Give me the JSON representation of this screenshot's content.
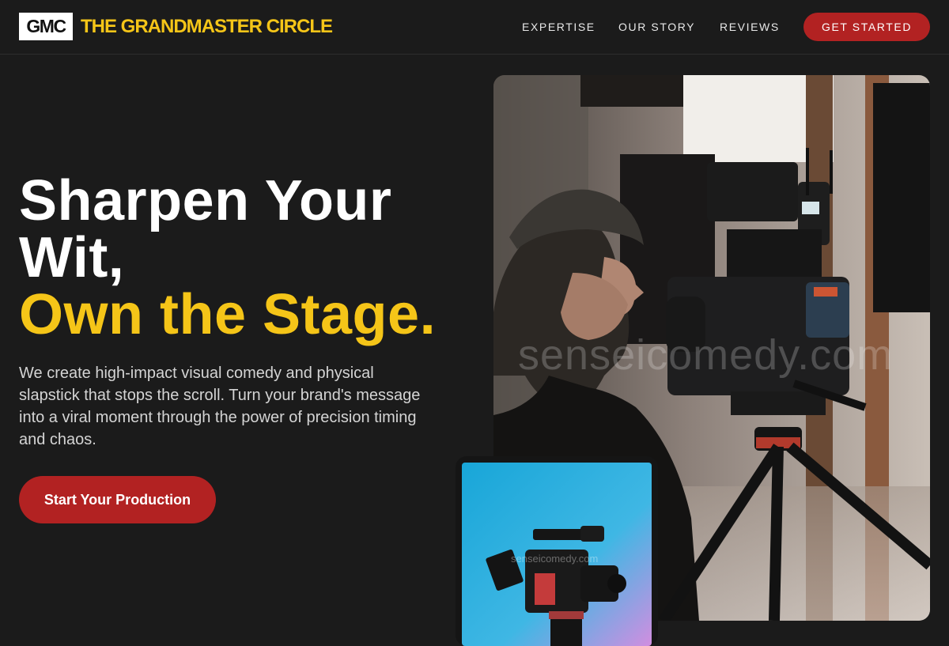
{
  "header": {
    "logo_text": "GMC",
    "brand_name": "THE GRANDMASTER CIRCLE",
    "nav": [
      {
        "label": "EXPERTISE"
      },
      {
        "label": "OUR STORY"
      },
      {
        "label": "REVIEWS"
      }
    ],
    "cta_label": "GET STARTED"
  },
  "hero": {
    "title_line1": "Sharpen Your",
    "title_line2": "Wit,",
    "title_accent": "Own the Stage.",
    "description": "We create high-impact visual comedy and physical slapstick that stops the scroll. Turn your brand's message into a viral moment through the power of precision timing and chaos.",
    "cta_label": "Start Your Production"
  },
  "media": {
    "main_image": "videographer-with-camera-on-tripod-photo",
    "inset_image": "cinema-camera-on-blue-pink-gradient-photo",
    "watermark": "senseicomedy.com"
  },
  "colors": {
    "background": "#1b1b1b",
    "accent_yellow": "#f5c518",
    "accent_red": "#b22222",
    "text_primary": "#ffffff",
    "text_secondary": "#d4d4d4"
  }
}
